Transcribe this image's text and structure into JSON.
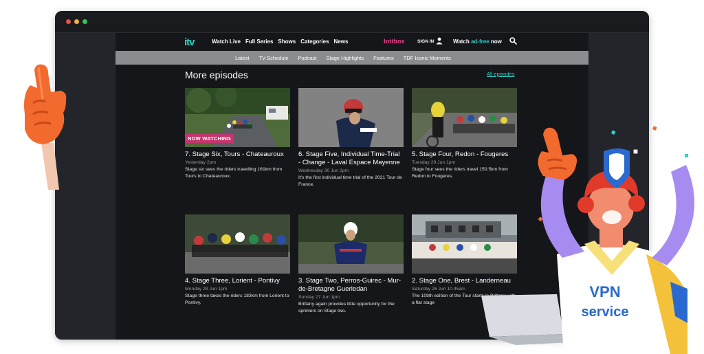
{
  "nav": {
    "logo": "itv",
    "links": [
      "Watch Live",
      "Full Series",
      "Shows",
      "Categories",
      "News"
    ],
    "britbox": "britbox",
    "signin": "SIGN IN",
    "watch_prefix": "Watch ",
    "watch_accent": "ad-free",
    "watch_suffix": " now"
  },
  "subnav": [
    "Latest",
    "TV Schedule",
    "Podcast",
    "Stage Highlights",
    "Features",
    "TDF Iconic Moments"
  ],
  "section": {
    "title": "More episodes",
    "all_link": "All episodes"
  },
  "episodes": [
    {
      "title": "7. Stage Six, Tours - Chateauroux",
      "date": "Yesterday 2pm",
      "desc": "Stage six sees the riders travelling 161km from Tours to Chateauroux.",
      "badge": "NOW WATCHING"
    },
    {
      "title": "6. Stage Five, Individual Time-Trial - Change - Laval Espace Mayenne",
      "date": "Wednesday 30 Jun 2pm",
      "desc": "It's the first individual time trial of the 2021 Tour de France."
    },
    {
      "title": "5. Stage Four, Redon - Fougeres",
      "date": "Tuesday 29 Jun 1pm",
      "desc": "Stage four sees the riders travel 150.5km from Redon to Fougeres."
    },
    {
      "title": "4. Stage Three, Lorient - Pontivy",
      "date": "Monday 28 Jun 1pm",
      "desc": "Stage three takes the riders 183km from Lorient to Pontivy."
    },
    {
      "title": "3. Stage Two, Perros-Guirec - Mur-de-Bretagne Guerledan",
      "date": "Sunday 27 Jun 1pm",
      "desc": "Brittany again provides little opportunity for the sprinters on Stage two."
    },
    {
      "title": "2. Stage One, Brest - Landerneau",
      "date": "Saturday 26 Jun 10.45am",
      "desc": "The 108th edition of the Tour starts in Brittany with a flat stage"
    }
  ],
  "mascot": {
    "shirt_line1": "VPN",
    "shirt_line2": "service"
  },
  "colors": {
    "accent": "#2bd4c8",
    "badge": "#c2366c",
    "brand_pink": "#e8418a"
  }
}
